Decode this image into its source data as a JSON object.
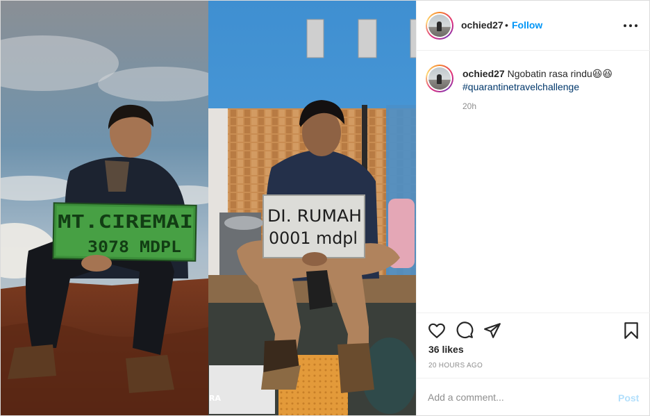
{
  "post": {
    "username": "ochied27",
    "separator": "•",
    "follow_label": "Follow",
    "more_icon": "more-horizontal-icon"
  },
  "photo": {
    "left_sign_line1": "MT.CIREMAI",
    "left_sign_line2": "3078 MDPL",
    "right_sign_line1": "DI. RUMAH",
    "right_sign_line2": "0001 mdpl",
    "watermark": "RA"
  },
  "caption": {
    "username": "ochied27",
    "text": "Ngobatin rasa rindu😆😆",
    "hashtag": "#quarantinetravelchallenge",
    "time": "20h"
  },
  "actions": {
    "like_icon": "heart-icon",
    "comment_icon": "comment-icon",
    "share_icon": "paper-plane-icon",
    "save_icon": "bookmark-icon"
  },
  "likes": "36 likes",
  "timestamp": "20 HOURS AGO",
  "comment_box": {
    "placeholder": "Add a comment...",
    "post_label": "Post"
  },
  "colors": {
    "accent": "#0095f6",
    "post_disabled": "#b2dffc",
    "hashtag": "#00376b",
    "muted": "#8e8e8e"
  }
}
